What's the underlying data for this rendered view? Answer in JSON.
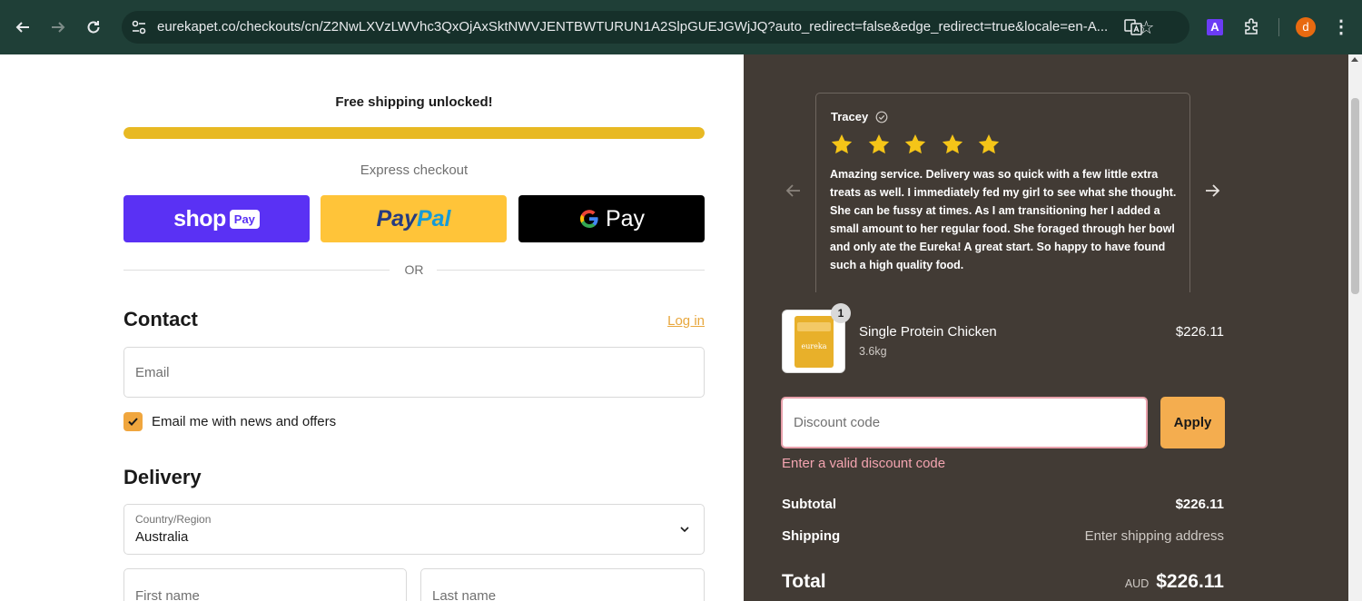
{
  "browser": {
    "url": "eurekapet.co/checkouts/cn/Z2NwLXVzLWVhc3QxOjAxSktNWVJENTBWTURUN1A2SlpGUEJGWjJQ?auto_redirect=false&edge_redirect=true&locale=en-A...",
    "extension_label": "A",
    "profile_initial": "d"
  },
  "checkout": {
    "free_shipping_text": "Free shipping unlocked!",
    "free_shipping_progress": 1.0,
    "express_label": "Express checkout",
    "shop_pay": {
      "word": "shop",
      "badge": "Pay"
    },
    "paypal": {
      "part1": "Pay",
      "part2": "Pal"
    },
    "gpay": {
      "g": "G",
      "word": "Pay"
    },
    "or_label": "OR",
    "contact_heading": "Contact",
    "login_link": "Log in",
    "email_placeholder": "Email",
    "news_checkbox_label": "Email me with news and offers",
    "news_checked": true,
    "delivery_heading": "Delivery",
    "country_label": "Country/Region",
    "country_value": "Australia",
    "first_name_placeholder": "First name",
    "last_name_placeholder": "Last name"
  },
  "review": {
    "reviewer": "Tracey",
    "rating": 5,
    "text": "Amazing service. Delivery was so quick with a few little extra treats as well. I immediately fed my girl to see what she thought. She can be fussy at times. As I am transitioning her I added a small amount to her regular food. She foraged through her bowl and only ate the Eureka! A great start. So happy to have found such a high quality food."
  },
  "order": {
    "product_name": "Single Protein Chicken",
    "product_variant": "3.6kg",
    "product_price": "$226.11",
    "quantity": "1",
    "product_image_brand": "eureka",
    "discount_placeholder": "Discount code",
    "apply_label": "Apply",
    "discount_error": "Enter a valid discount code",
    "subtotal_label": "Subtotal",
    "subtotal_value": "$226.11",
    "shipping_label": "Shipping",
    "shipping_value": "Enter shipping address",
    "total_label": "Total",
    "total_currency": "AUD",
    "total_value": "$226.11"
  },
  "colors": {
    "chrome_bg": "#1f3f37",
    "summary_bg": "#423b35",
    "accent_orange": "#f4ad4f",
    "progress_yellow": "#e8b923",
    "shop_pay_purple": "#5a31f4",
    "paypal_yellow": "#ffc439",
    "error_pink": "#f3a4b0",
    "star_yellow": "#f5c518"
  }
}
